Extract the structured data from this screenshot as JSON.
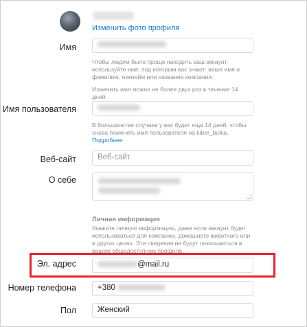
{
  "profile": {
    "change_photo_label": "Изменить фото профиля"
  },
  "fields": {
    "name": {
      "label": "Имя",
      "help_1": "Чтобы людям было проще находить ваш аккаунт, используйте имя, под которым вас знают: ваше имя и фамилию, никнейм или название компании.",
      "help_2": "Изменить имя можно не более двух раз в течение 14 дней."
    },
    "username": {
      "label": "Имя пользователя",
      "help": "В большинстве случаев у вас будет еще 14 дней, чтобы снова поменять имя пользователя на kiber_bulka.",
      "help_link": "Подробнее"
    },
    "website": {
      "label": "Веб-сайт",
      "placeholder": "Веб-сайт"
    },
    "bio": {
      "label": "О себе"
    },
    "personal_info": {
      "title": "Личная информация",
      "help": "Укажите личную информацию, даже если аккаунт будет использоваться для компании, домашнего животного или в других целях. Эти сведения не будут показываться в вашем общедоступном профиле."
    },
    "email": {
      "label": "Эл. адрес",
      "value_suffix": "@mail.ru"
    },
    "phone": {
      "label": "Номер телефона",
      "value_prefix": "+380"
    },
    "gender": {
      "label": "Пол",
      "value": "Женский"
    }
  },
  "colors": {
    "link": "#1a7bd6",
    "highlight": "#e8202a",
    "muted": "#8e8e8e",
    "border": "#dbdbdb"
  }
}
